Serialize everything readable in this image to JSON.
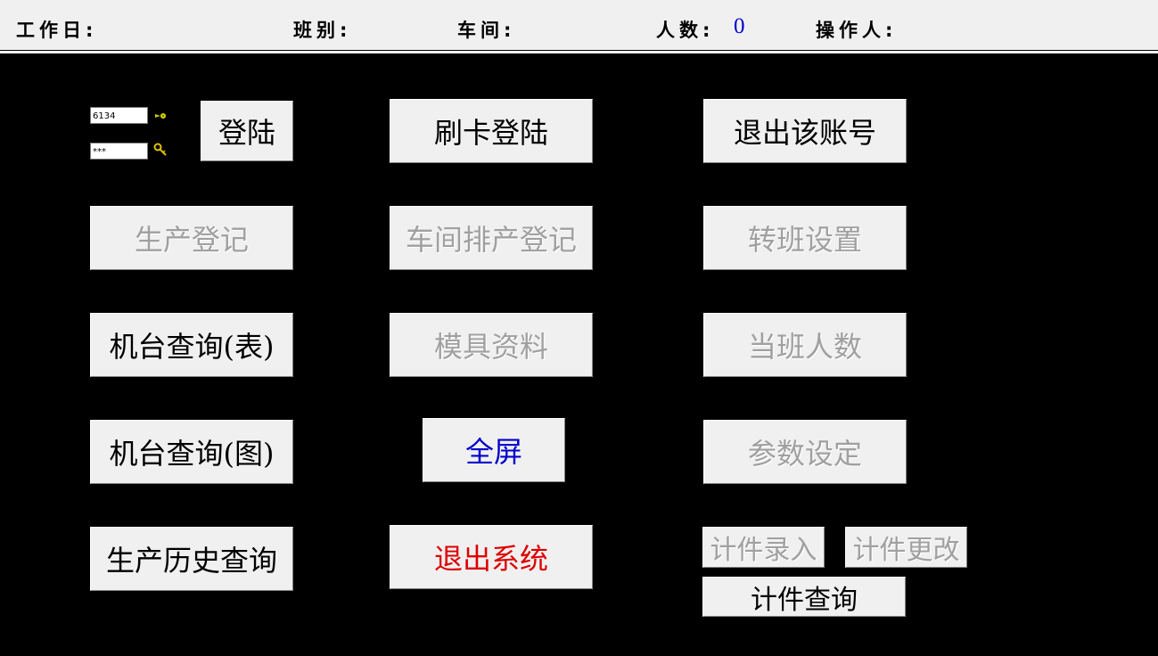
{
  "header": {
    "workday_label": "工作日:",
    "shift_label": "班别:",
    "workshop_label": "车间:",
    "headcount_label": "人数:",
    "headcount_value": "0",
    "operator_label": "操作人:"
  },
  "login": {
    "username_value": "6134",
    "password_value": "***",
    "user_icon": "user-pointer-icon",
    "password_icon": "key-icon",
    "login_button": "登陆",
    "card_login_button": "刷卡登陆",
    "logout_button": "退出该账号"
  },
  "buttons": {
    "production_register": "生产登记",
    "workshop_schedule_register": "车间排产登记",
    "shift_transfer_settings": "转班设置",
    "machine_query_table": "机台查询(表)",
    "mold_data": "模具资料",
    "current_shift_headcount": "当班人数",
    "machine_query_chart": "机台查询(图)",
    "full_screen": "全屏",
    "parameter_settings": "参数设定",
    "production_history_query": "生产历史查询",
    "exit_system": "退出系统",
    "piecework_entry": "计件录入",
    "piecework_change": "计件更改",
    "piecework_query": "计件查询"
  },
  "colors": {
    "background": "#000000",
    "button_face": "#f0f0f0",
    "disabled_text": "#a0a0a0",
    "headcount_value": "#0000cc",
    "full_screen_text": "#0000cc",
    "exit_text": "#dd0000"
  }
}
